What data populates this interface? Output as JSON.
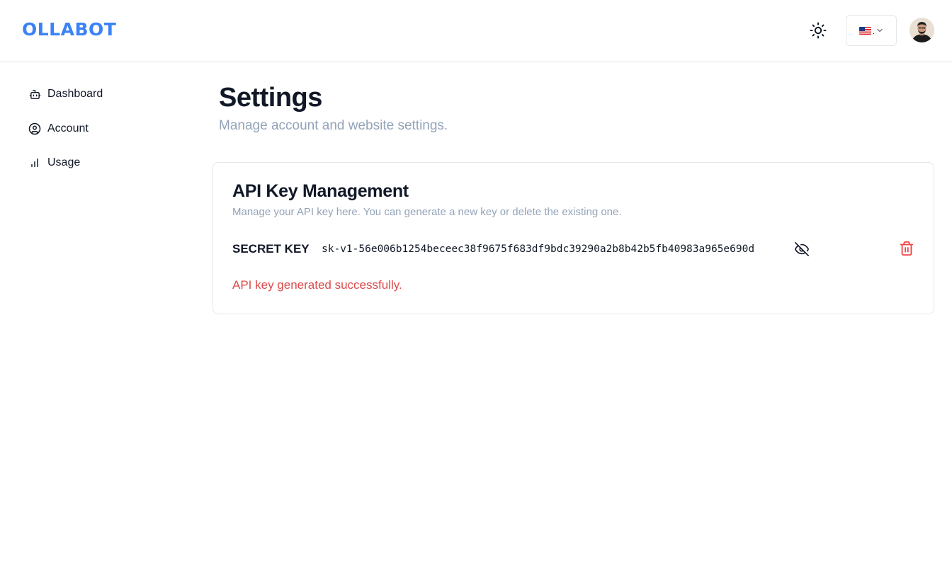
{
  "app": {
    "logo_text": "OLLABOT",
    "brand_color": "#3b82f6"
  },
  "header": {
    "theme_toggle_icon": "sun-icon",
    "language": {
      "flag_icon": "us-flag-icon",
      "selected_text": ".",
      "chevron_icon": "chevron-down-icon"
    },
    "avatar_icon": "user-avatar"
  },
  "sidebar": {
    "items": [
      {
        "label": "Dashboard",
        "icon": "robot-icon"
      },
      {
        "label": "Account",
        "icon": "user-circle-icon"
      },
      {
        "label": "Usage",
        "icon": "bar-chart-icon"
      }
    ]
  },
  "main": {
    "title": "Settings",
    "subtitle": "Manage account and website settings."
  },
  "api_card": {
    "title": "API Key Management",
    "description": "Manage your API key here. You can generate a new key or delete the existing one.",
    "secret_key_label": "SECRET KEY",
    "secret_key_value": "sk-v1-56e006b1254beceec38f9675f683df9bdc39290a2b8b42b5fb40983a965e690d",
    "visibility_icon": "eye-off-icon",
    "delete_icon": "trash-icon",
    "status_message": "API key generated successfully.",
    "status_color": "#dc4b4b",
    "delete_color": "#ef4444"
  }
}
